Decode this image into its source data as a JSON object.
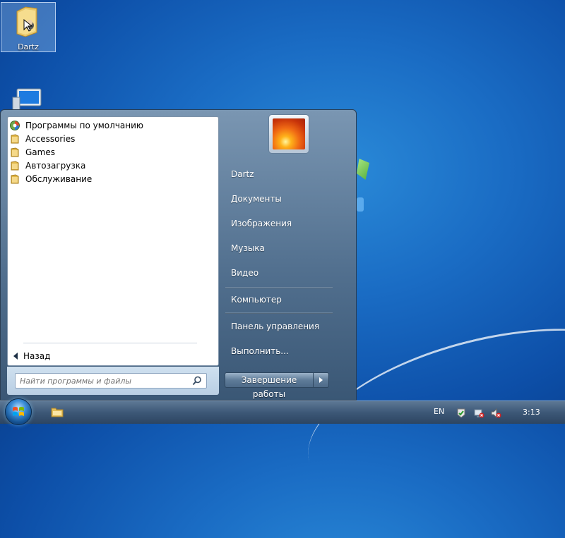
{
  "desktop": {
    "icons": [
      {
        "label": "Dartz",
        "icon": "user-folder-icon"
      },
      {
        "label": "",
        "icon": "computer-icon"
      }
    ]
  },
  "start_menu": {
    "programs": [
      {
        "label": "Программы по умолчанию",
        "icon": "default-programs-icon"
      },
      {
        "label": "Accessories",
        "icon": "folder-icon"
      },
      {
        "label": "Games",
        "icon": "folder-icon"
      },
      {
        "label": "Автозагрузка",
        "icon": "folder-icon"
      },
      {
        "label": "Обслуживание",
        "icon": "folder-icon"
      }
    ],
    "back_label": "Назад",
    "search": {
      "placeholder": "Найти программы и файлы",
      "value": ""
    },
    "right_items": [
      {
        "label": "Dartz"
      },
      {
        "label": "Документы"
      },
      {
        "label": "Изображения"
      },
      {
        "label": "Музыка"
      },
      {
        "label": "Видео"
      },
      {
        "label": "Компьютер"
      },
      {
        "label": "Панель управления"
      },
      {
        "label": "Выполнить..."
      }
    ],
    "shutdown_label": "Завершение работы"
  },
  "taskbar": {
    "language": "EN",
    "clock": "3:13",
    "tray_icons": [
      "action-center-icon",
      "network-icon",
      "volume-muted-icon"
    ]
  },
  "colors": {
    "desktop_blue": "#1a6cc4",
    "menu_pane": "#52708f",
    "taskbar": "#3d5877"
  }
}
